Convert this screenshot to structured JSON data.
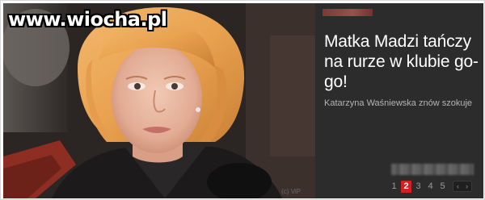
{
  "watermark": {
    "text": "www.wiocha.pl"
  },
  "photo": {
    "credit": "(c) ViP"
  },
  "article": {
    "headline": "Matka Madzi tańczy na rurze w klubie go-go!",
    "subtitle": "Katarzyna Waśniewska znów szokuje"
  },
  "pager": {
    "pages": [
      "1",
      "2",
      "3",
      "4",
      "5"
    ],
    "active_index": 1,
    "prev_icon": "chevron-left-icon",
    "next_icon": "chevron-right-icon",
    "prev_glyph": "‹",
    "next_glyph": "›"
  },
  "colors": {
    "panel_bg": "#2c2c2c",
    "accent": "#d42020",
    "headline": "#ffffff",
    "subtitle": "#b4b4b4"
  }
}
